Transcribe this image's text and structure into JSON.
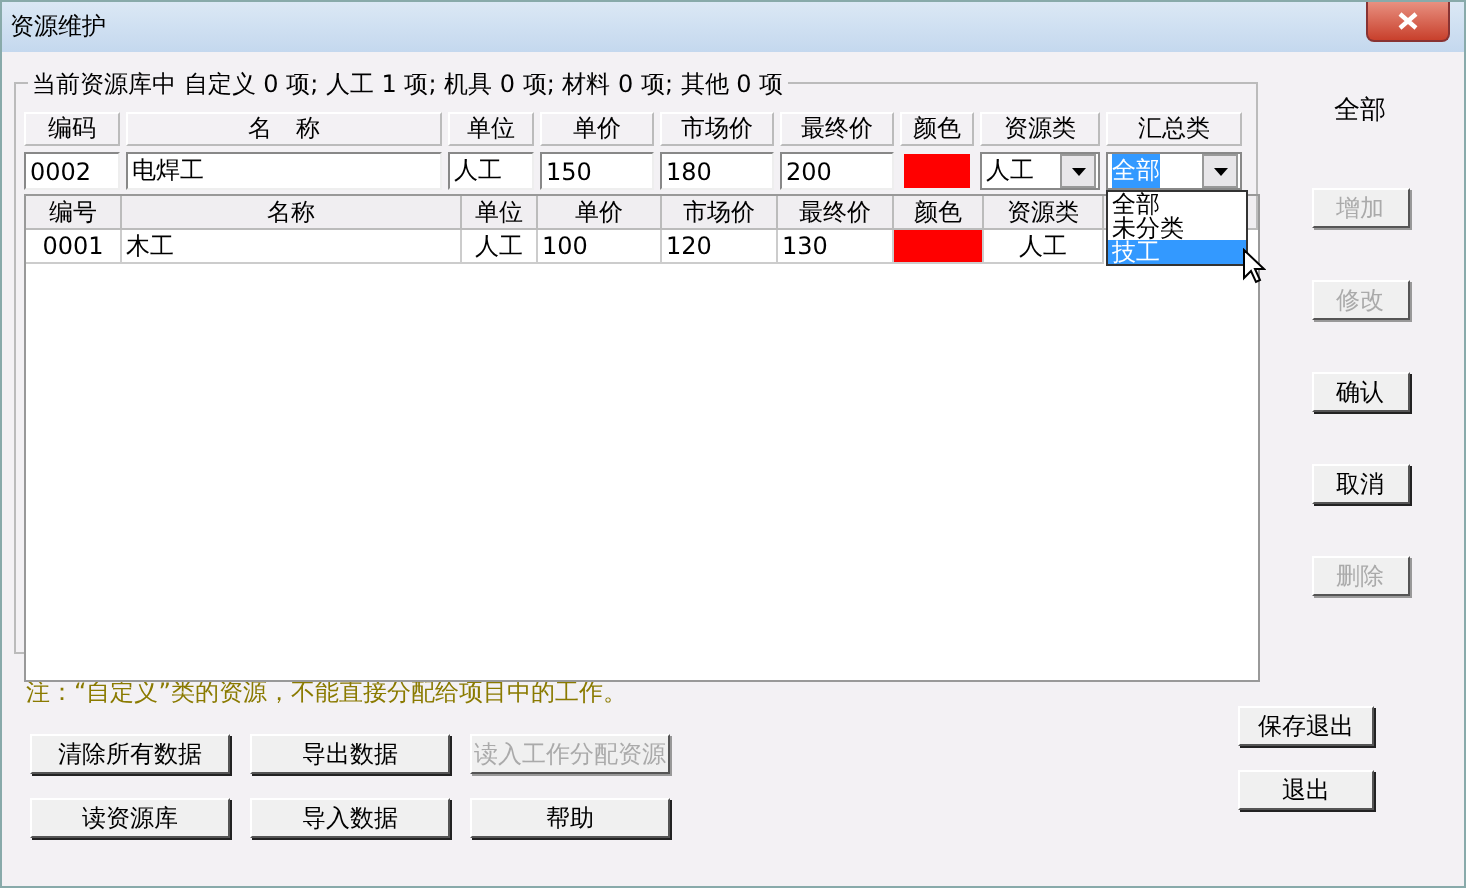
{
  "window": {
    "title": "资源维护"
  },
  "group": {
    "legend": "当前资源库中 自定义 0 项; 人工 1 项; 机具 0 项; 材料 0 项; 其他 0 项"
  },
  "edit_form": {
    "columns": [
      "编码",
      "名　称",
      "单位",
      "单价",
      "市场价",
      "最终价",
      "颜色",
      "资源类",
      "汇总类"
    ],
    "code": "0002",
    "name": "电焊工",
    "unit": "人工",
    "price": "150",
    "market_price": "180",
    "final_price": "200",
    "color": "#ff0000",
    "resource_type": "人工",
    "summary_type": "全部",
    "summary_options": [
      {
        "label": "全部",
        "selected": false
      },
      {
        "label": "未分类",
        "selected": false
      },
      {
        "label": "技工",
        "selected": true
      }
    ]
  },
  "summary_label": "全部",
  "table": {
    "columns": [
      "编号",
      "名称",
      "单位",
      "单价",
      "市场价",
      "最终价",
      "颜色",
      "资源类"
    ],
    "rows": [
      {
        "code": "0001",
        "name": "木工",
        "unit": "人工",
        "price": "100",
        "market_price": "120",
        "final_price": "130",
        "color": "#ff0000",
        "resource_type": "人工"
      }
    ]
  },
  "side_buttons": [
    {
      "label": "增加",
      "disabled": true
    },
    {
      "label": "修改",
      "disabled": true
    },
    {
      "label": "确认",
      "disabled": false
    },
    {
      "label": "取消",
      "disabled": false
    },
    {
      "label": "删除",
      "disabled": true
    }
  ],
  "note": "注：“自定义”类的资源，不能直接分配给项目中的工作。",
  "bottom_buttons": [
    {
      "label": "清除所有数据",
      "disabled": false
    },
    {
      "label": "导出数据",
      "disabled": false
    },
    {
      "label": "读入工作分配资源",
      "disabled": true
    },
    {
      "label": "读资源库",
      "disabled": false
    },
    {
      "label": "导入数据",
      "disabled": false
    },
    {
      "label": "帮助",
      "disabled": false
    }
  ],
  "right_buttons": [
    {
      "label": "保存退出",
      "disabled": false
    },
    {
      "label": "退出",
      "disabled": false
    }
  ]
}
